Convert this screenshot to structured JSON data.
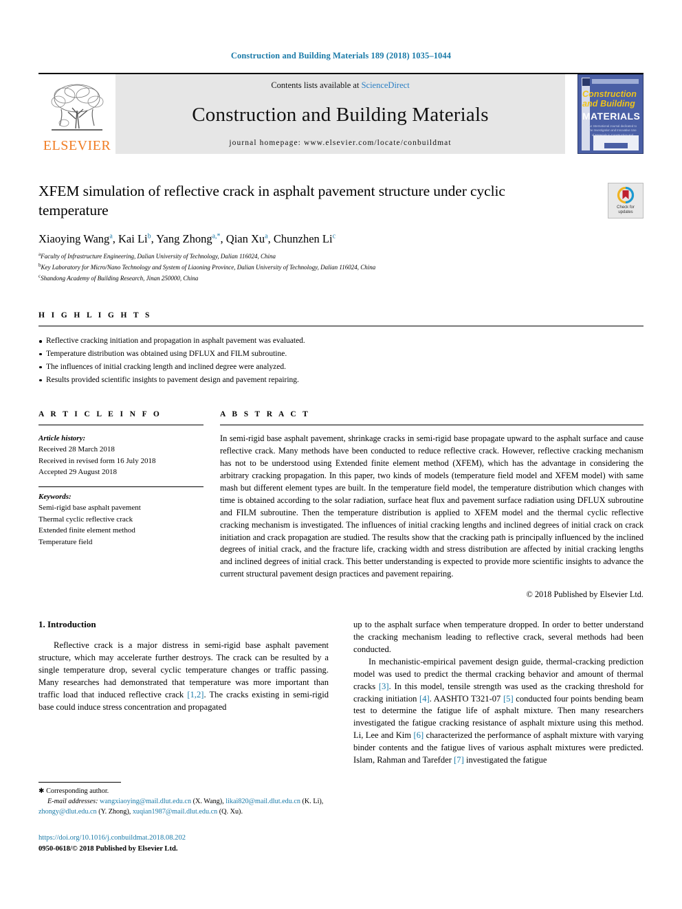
{
  "running_head": "Construction and Building Materials 189 (2018) 1035–1044",
  "masthead": {
    "publisher": "ELSEVIER",
    "contents_prefix": "Contents lists available at ",
    "contents_link": "ScienceDirect",
    "journal_title": "Construction and Building Materials",
    "homepage": "journal homepage: www.elsevier.com/locate/conbuildmat",
    "cover": {
      "line1": "Construction",
      "line2": "and Building",
      "line3": "MATERIALS",
      "subtitle": "An International Journal dedicated to the Investigation and Innovative Use of Materials in Construction and Repair"
    }
  },
  "crossmark": {
    "line1": "Check for",
    "line2": "updates"
  },
  "article": {
    "title": "XFEM simulation of reflective crack in asphalt pavement structure under cyclic temperature",
    "authors": [
      {
        "name": "Xiaoying Wang",
        "sup": "a",
        "sep": ", "
      },
      {
        "name": "Kai Li",
        "sup": "b",
        "sep": ", "
      },
      {
        "name": "Yang Zhong",
        "sup": "a,*",
        "sep": ", "
      },
      {
        "name": "Qian Xu",
        "sup": "a",
        "sep": ", "
      },
      {
        "name": "Chunzhen Li",
        "sup": "c",
        "sep": ""
      }
    ],
    "affiliations": [
      {
        "marker": "a",
        "text": "Faculty of Infrastructure Engineering, Dalian University of Technology, Dalian 116024, China"
      },
      {
        "marker": "b",
        "text": "Key Laboratory for Micro/Nano Technology and System of Liaoning Province, Dalian University of Technology, Dalian 116024, China"
      },
      {
        "marker": "c",
        "text": "Shandong Academy of Building Research, Jinan 250000, China"
      }
    ]
  },
  "highlights": {
    "heading": "H I G H L I G H T S",
    "items": [
      "Reflective cracking initiation and propagation in asphalt pavement was evaluated.",
      "Temperature distribution was obtained using DFLUX and FILM subroutine.",
      "The influences of initial cracking length and inclined degree were analyzed.",
      "Results provided scientific insights to pavement design and pavement repairing."
    ]
  },
  "article_info": {
    "heading": "A R T I C L E   I N F O",
    "history_label": "Article history:",
    "history": [
      "Received 28 March 2018",
      "Received in revised form 16 July 2018",
      "Accepted 29 August 2018"
    ],
    "keywords_label": "Keywords:",
    "keywords": [
      "Semi-rigid base asphalt pavement",
      "Thermal cyclic reflective crack",
      "Extended finite element method",
      "Temperature field"
    ]
  },
  "abstract": {
    "heading": "A B S T R A C T",
    "text": "In semi-rigid base asphalt pavement, shrinkage cracks in semi-rigid base propagate upward to the asphalt surface and cause reflective crack. Many methods have been conducted to reduce reflective crack. However, reflective cracking mechanism has not to be understood using Extended finite element method (XFEM), which has the advantage in considering the arbitrary cracking propagation. In this paper, two kinds of models (temperature field model and XFEM model) with same mash but different element types are built. In the temperature field model, the temperature distribution which changes with time is obtained according to the solar radiation, surface heat flux and pavement surface radiation using DFLUX subroutine and FILM subroutine. Then the temperature distribution is applied to XFEM model and the thermal cyclic reflective cracking mechanism is investigated. The influences of initial cracking lengths and inclined degrees of initial crack on crack initiation and crack propagation are studied. The results show that the cracking path is principally influenced by the inclined degrees of initial crack, and the fracture life, cracking width and stress distribution are affected by initial cracking lengths and inclined degrees of initial crack. This better understanding is expected to provide more scientific insights to advance the current structural pavement design practices and pavement repairing.",
    "copyright": "© 2018 Published by Elsevier Ltd."
  },
  "introduction": {
    "heading": "1. Introduction",
    "left_paragraph_1": "Reflective crack is a major distress in semi-rigid base asphalt pavement structure, which may accelerate further destroys. The crack can be resulted by a single temperature drop, several cyclic temperature changes or traffic passing. Many researches had demonstrated that temperature was more important than traffic load that induced reflective crack ",
    "left_ref_1": "[1,2]",
    "left_paragraph_1b": ". The cracks existing in semi-rigid base could induce stress concentration and propagated",
    "right_paragraph_1": "up to the asphalt surface when temperature dropped. In order to better understand the cracking mechanism leading to reflective crack, several methods had been conducted.",
    "right_paragraph_2a": "In mechanistic-empirical pavement design guide, thermal-cracking prediction model was used to predict the thermal cracking behavior and amount of thermal cracks ",
    "right_ref_3": "[3]",
    "right_paragraph_2b": ". In this model, tensile strength was used as the cracking threshold for cracking initiation ",
    "right_ref_4": "[4]",
    "right_paragraph_2c": ". AASHTO T321-07 ",
    "right_ref_5": "[5]",
    "right_paragraph_2d": " conducted four points bending beam test to determine the fatigue life of asphalt mixture. Then many researchers investigated the fatigue cracking resistance of asphalt mixture using this method. Li, Lee and Kim ",
    "right_ref_6": "[6]",
    "right_paragraph_2e": " characterized the performance of asphalt mixture with varying binder contents and the fatigue lives of various asphalt mixtures were predicted. Islam, Rahman and Tarefder ",
    "right_ref_7": "[7]",
    "right_paragraph_2f": " investigated the fatigue"
  },
  "footnote": {
    "corresponding": "Corresponding author.",
    "email_label": "E-mail addresses:",
    "emails": [
      {
        "address": "wangxiaoying@mail.dlut.edu.cn",
        "who": " (X. Wang), "
      },
      {
        "address": "likai820@mail.dlut.edu.cn",
        "who": " (K. Li), "
      },
      {
        "address": "zhongy@dlut.edu.cn",
        "who": " (Y. Zhong), "
      },
      {
        "address": "xuqian1987@mail.dlut.edu.cn",
        "who": " (Q. Xu)."
      }
    ],
    "doi": "https://doi.org/10.1016/j.conbuildmat.2018.08.202",
    "issn_line": "0950-0618/© 2018 Published by Elsevier Ltd."
  },
  "colors": {
    "link": "#1a7aa8",
    "sciencedirect": "#2b7fc4",
    "elsevier_orange": "#f07c23",
    "cover_blue": "#4a5fa5",
    "band_gray": "#e6e6e6"
  }
}
